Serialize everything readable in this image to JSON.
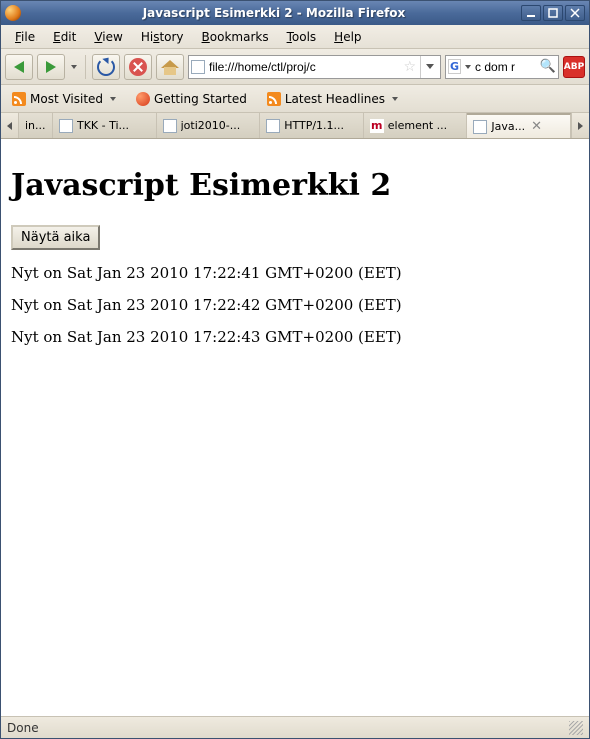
{
  "window": {
    "title": "Javascript Esimerkki 2 - Mozilla Firefox"
  },
  "menu": {
    "file": "File",
    "edit": "Edit",
    "view": "View",
    "history": "History",
    "bookmarks": "Bookmarks",
    "tools": "Tools",
    "help": "Help"
  },
  "toolbar": {
    "url": "file:///home/ctl/proj/c",
    "search_value": "c dom r"
  },
  "bookmarks_bar": {
    "most_visited": "Most Visited",
    "getting_started": "Getting Started",
    "latest_headlines": "Latest Headlines"
  },
  "tabs": {
    "items": [
      {
        "label": "in..."
      },
      {
        "label": "TKK - Ti..."
      },
      {
        "label": "joti2010-..."
      },
      {
        "label": "HTTP/1.1..."
      },
      {
        "label": "element ..."
      },
      {
        "label": "Java..."
      }
    ]
  },
  "page": {
    "heading": "Javascript Esimerkki 2",
    "button_label": "Näytä aika",
    "lines": [
      "Nyt on Sat Jan 23 2010 17:22:41 GMT+0200 (EET)",
      "Nyt on Sat Jan 23 2010 17:22:42 GMT+0200 (EET)",
      "Nyt on Sat Jan 23 2010 17:22:43 GMT+0200 (EET)"
    ]
  },
  "status": {
    "text": "Done"
  }
}
